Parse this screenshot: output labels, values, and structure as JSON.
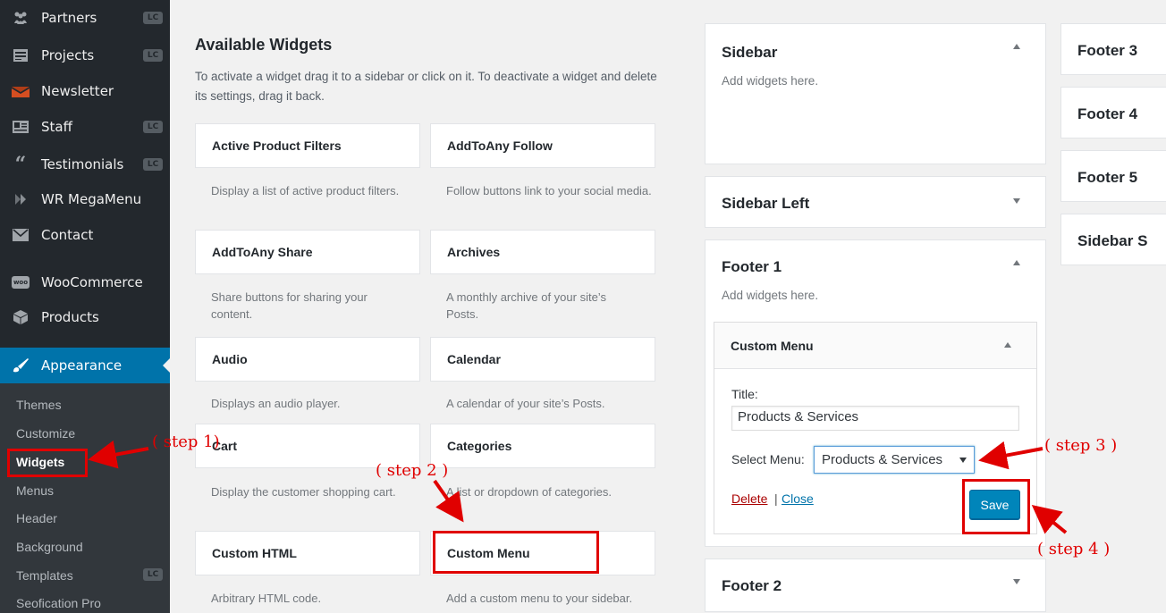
{
  "sidebar": {
    "items": [
      {
        "label": "Partners",
        "badge": "LC",
        "icon": "partners-icon"
      },
      {
        "label": "Projects",
        "badge": "LC",
        "icon": "projects-icon"
      },
      {
        "label": "Newsletter",
        "badge": "",
        "icon": "newsletter-icon"
      },
      {
        "label": "Staff",
        "badge": "LC",
        "icon": "staff-icon"
      },
      {
        "label": "Testimonials",
        "badge": "LC",
        "icon": "quote-icon"
      },
      {
        "label": "WR MegaMenu",
        "badge": "",
        "icon": "megamenu-icon"
      },
      {
        "label": "Contact",
        "badge": "",
        "icon": "mail-icon"
      },
      {
        "label": "WooCommerce",
        "badge": "",
        "icon": "woocommerce-icon"
      },
      {
        "label": "Products",
        "badge": "",
        "icon": "products-icon"
      }
    ],
    "appearance_label": "Appearance",
    "submenu": [
      {
        "label": "Themes",
        "badge": ""
      },
      {
        "label": "Customize",
        "badge": ""
      },
      {
        "label": "Widgets",
        "badge": ""
      },
      {
        "label": "Menus",
        "badge": ""
      },
      {
        "label": "Header",
        "badge": ""
      },
      {
        "label": "Background",
        "badge": ""
      },
      {
        "label": "Templates",
        "badge": "LC"
      },
      {
        "label": "Seofication Pro",
        "badge": ""
      }
    ]
  },
  "available": {
    "title": "Available Widgets",
    "description": "To activate a widget drag it to a sidebar or click on it. To deactivate a widget and delete its settings, drag it back.",
    "widgets": [
      {
        "name": "Active Product Filters",
        "desc": "Display a list of active product filters."
      },
      {
        "name": "AddToAny Follow",
        "desc": "Follow buttons link to your social media."
      },
      {
        "name": "AddToAny Share",
        "desc": "Share buttons for sharing your content."
      },
      {
        "name": "Archives",
        "desc": "A monthly archive of your site’s Posts."
      },
      {
        "name": "Audio",
        "desc": "Displays an audio player."
      },
      {
        "name": "Calendar",
        "desc": "A calendar of your site’s Posts."
      },
      {
        "name": "Cart",
        "desc": "Display the customer shopping cart."
      },
      {
        "name": "Categories",
        "desc": "A list or dropdown of categories."
      },
      {
        "name": "Custom HTML",
        "desc": "Arbitrary HTML code."
      },
      {
        "name": "Custom Menu",
        "desc": "Add a custom menu to your sidebar."
      }
    ]
  },
  "areas": {
    "sidebar": {
      "title": "Sidebar",
      "hint": "Add widgets here."
    },
    "sidebar_left": {
      "title": "Sidebar Left"
    },
    "footer1": {
      "title": "Footer 1",
      "hint": "Add widgets here."
    },
    "footer2": {
      "title": "Footer 2"
    },
    "footer3": {
      "title": "Footer 3"
    },
    "footer4": {
      "title": "Footer 4"
    },
    "footer5": {
      "title": "Footer 5"
    },
    "sidebar_s": {
      "title": "Sidebar S"
    }
  },
  "custom_menu_widget": {
    "title": "Custom Menu",
    "title_label": "Title:",
    "title_value": "Products & Services",
    "select_label": "Select Menu:",
    "select_value": "Products & Services",
    "delete_label": "Delete",
    "separator": "|",
    "close_label": "Close",
    "save_label": "Save"
  },
  "annotations": {
    "step1": "( step 1)",
    "step2": "( step 2 )",
    "step3": "( step 3 )",
    "step4": "( step 4 )",
    "color": "#e00000"
  }
}
